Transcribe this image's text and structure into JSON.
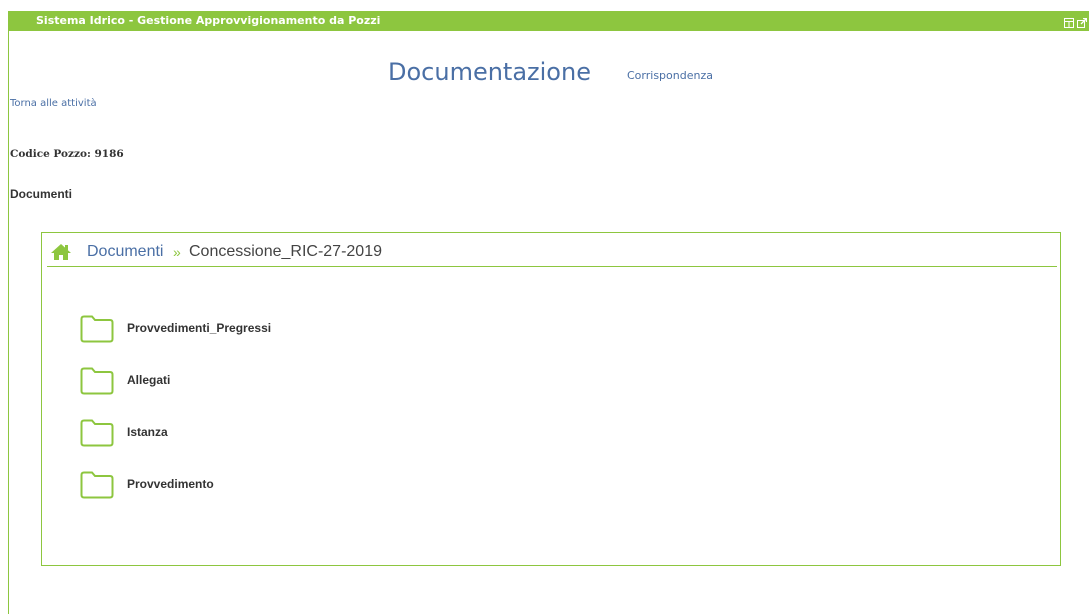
{
  "portlet": {
    "title": "Sistema Idrico - Gestione Approvvigionamento da Pozzi",
    "controls": [
      "maximize-icon",
      "popout-icon"
    ],
    "accent_color": "#8dc63f"
  },
  "header": {
    "title": "Documentazione",
    "corrispondenza_link": "Corrispondenza"
  },
  "nav": {
    "back_link": "Torna alle attività"
  },
  "well": {
    "codice_label": "Codice Pozzo: 9186"
  },
  "documents": {
    "section_title": "Documenti",
    "breadcrumb": {
      "icon": "home-icon",
      "root": "Documenti",
      "separator": "»",
      "current": "Concessione_RIC-27-2019"
    },
    "folders": [
      {
        "name": "Provvedimenti_Pregressi",
        "icon": "folder-icon"
      },
      {
        "name": "Allegati",
        "icon": "folder-icon"
      },
      {
        "name": "Istanza",
        "icon": "folder-icon"
      },
      {
        "name": "Provvedimento",
        "icon": "folder-icon"
      }
    ]
  }
}
